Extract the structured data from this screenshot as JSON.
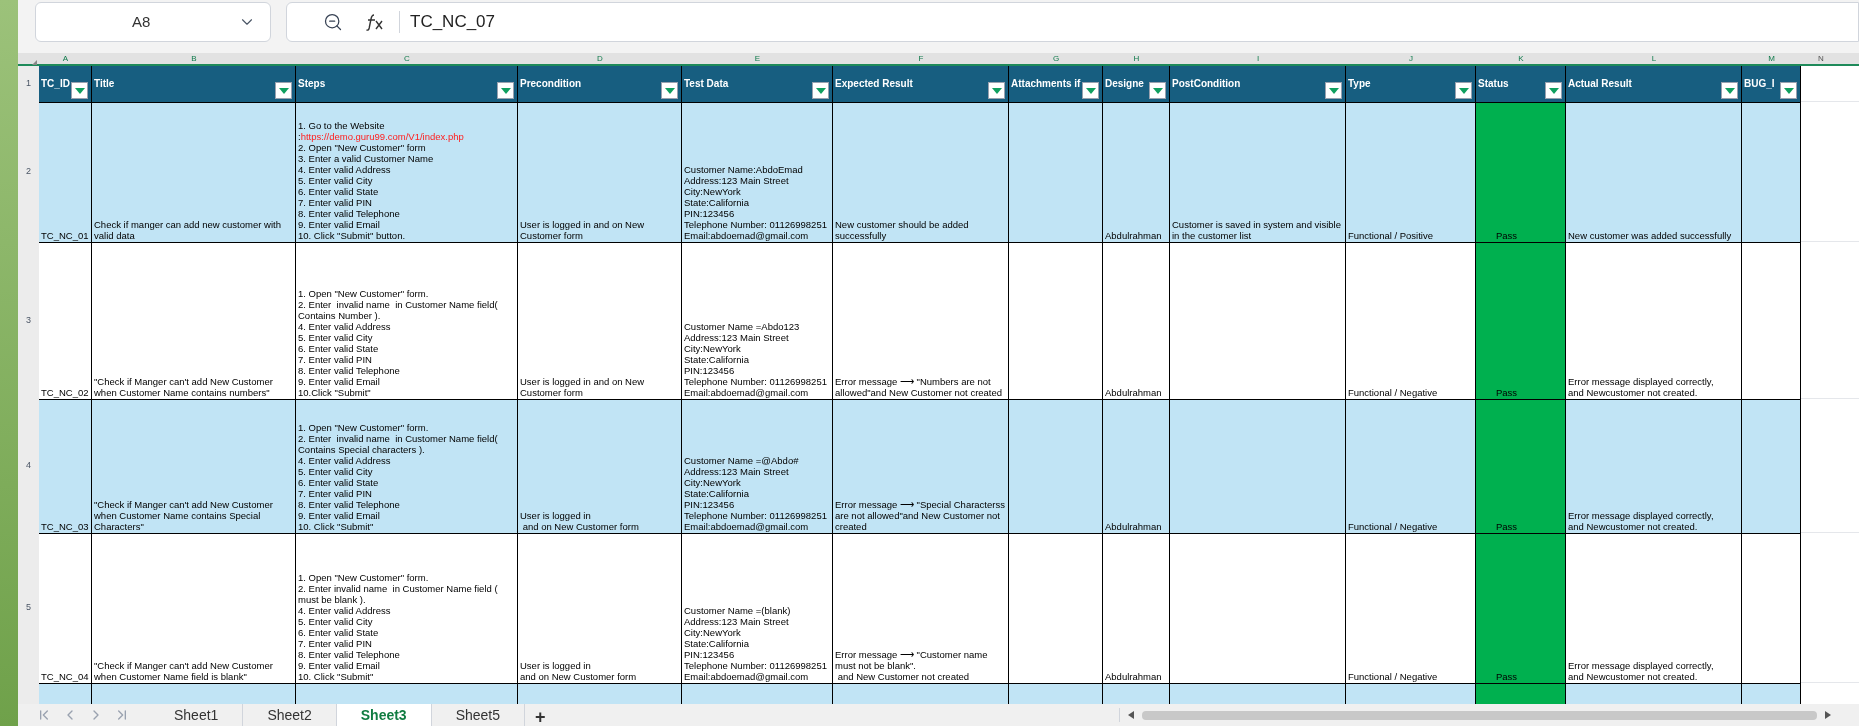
{
  "name_box": {
    "value": "A8"
  },
  "formula_bar": {
    "value": "TC_NC_07"
  },
  "columns": [
    {
      "letter": "A",
      "header": "TC_ID",
      "kind": "text"
    },
    {
      "letter": "B",
      "header": "Title",
      "kind": "text"
    },
    {
      "letter": "C",
      "header": "Steps",
      "kind": "text"
    },
    {
      "letter": "D",
      "header": "Precondition",
      "kind": "text"
    },
    {
      "letter": "E",
      "header": "Test Data",
      "kind": "text"
    },
    {
      "letter": "F",
      "header": "Expected Result",
      "kind": "text"
    },
    {
      "letter": "G",
      "header": "Attachments if",
      "kind": "text"
    },
    {
      "letter": "H",
      "header": "Designe",
      "kind": "text"
    },
    {
      "letter": "I",
      "header": "PostCondition",
      "kind": "text"
    },
    {
      "letter": "J",
      "header": "Type",
      "kind": "text"
    },
    {
      "letter": "K",
      "header": "Status",
      "kind": "status"
    },
    {
      "letter": "L",
      "header": "Actual Result",
      "kind": "text"
    },
    {
      "letter": "M",
      "header": "BUG_I",
      "kind": "text"
    }
  ],
  "extra_column": {
    "letter": "N"
  },
  "header_row_number": "1",
  "rows": [
    {
      "number": "2",
      "cells": [
        "TC_NC_01",
        "Check if manger can add new customer with valid data",
        {
          "segments": [
            {
              "text": "1. Go to the Website\n:"
            },
            {
              "text": "https://demo.guru99.com/V1/index.php",
              "kind": "link"
            },
            {
              "text": "\n2. Open \"New Customer\" form\n3. Enter a valid Customer Name\n4. Enter valid Address\n5. Enter valid City\n6. Enter valid State\n7. Enter valid PIN\n8. Enter valid Telephone\n9. Enter valid Email\n10. Click \"Submit\" button."
            }
          ]
        },
        "User is logged in and on New Customer form",
        "Customer Name:AbdoEmad\nAddress:123 Main Street\nCity:NewYork\nState:California\nPIN:123456\nTelephone Number: 01126998251\nEmail:abdoemad@gmail.com",
        "New customer should be added successfully",
        "",
        "Abdulrahman",
        "Customer is saved in system and visible in the customer list",
        "Functional / Positive",
        "Pass",
        "New customer was added successfully",
        ""
      ]
    },
    {
      "number": "3",
      "cells": [
        "TC_NC_02",
        "\"Check if Manger can't add New Customer when Customer Name contains numbers\"",
        "1. Open \"New Customer\" form.\n2. Enter  invalid name  in Customer Name field( Contains Number ).\n4. Enter valid Address\n5. Enter valid City\n6. Enter valid State\n7. Enter valid PIN\n8. Enter valid Telephone\n9. Enter valid Email\n10.Click \"Submit\"",
        "User is logged in and on New Customer form",
        "Customer Name =Abdo123\nAddress:123 Main Street\nCity:NewYork\nState:California\nPIN:123456\nTelephone Number: 01126998251\nEmail:abdoemad@gmail.com",
        "Error message ⟶ \"Numbers are not allowed\"and New Customer not created",
        "",
        "Abdulrahman",
        "",
        "Functional / Negative",
        "Pass",
        "Error message displayed correctly,\nand Newcustomer not created.",
        ""
      ]
    },
    {
      "number": "4",
      "cells": [
        "TC_NC_03",
        "\"Check if Manger can't add New Customer when Customer Name contains Special Characters\"",
        "1. Open \"New Customer\" form.\n2. Enter  invalid name  in Customer Name field( Contains Special characters ).\n4. Enter valid Address\n5. Enter valid City\n6. Enter valid State\n7. Enter valid PIN\n8. Enter valid Telephone\n9. Enter valid Email\n10. Click \"Submit\"",
        "User is logged in\n and on New Customer form",
        "Customer Name =@Abdo#\nAddress:123 Main Street\nCity:NewYork\nState:California\nPIN:123456\nTelephone Number: 01126998251\nEmail:abdoemad@gmail.com",
        "Error message ⟶ \"Special Characterss are not allowed\"and New Customer not created",
        "",
        "Abdulrahman",
        "",
        "Functional / Negative",
        "Pass",
        "Error message displayed correctly,\nand Newcustomer not created.",
        ""
      ]
    },
    {
      "number": "5",
      "cells": [
        "TC_NC_04",
        "\"Check if Manger can't add New Customer when Customer Name field is blank\"",
        "1. Open \"New Customer\" form.\n2. Enter invalid name  in Customer Name field ( must be blank ).\n4. Enter valid Address\n5. Enter valid City\n6. Enter valid State\n7. Enter valid PIN\n8. Enter valid Telephone\n9. Enter valid Email\n10. Click \"Submit\"",
        "User is logged in\nand on New Customer form",
        "Customer Name =(blank)\nAddress:123 Main Street\nCity:NewYork\nState:California\nPIN:123456\nTelephone Number: 01126998251\nEmail:abdoemad@gmail.com",
        "Error message ⟶ \"Customer name must not be blank\".\n and New Customer not created",
        "",
        "Abdulrahman",
        "",
        "Functional / Negative",
        "Pass",
        "Error message displayed correctly,\nand Newcustomer not created.",
        ""
      ]
    }
  ],
  "sheet_tabs": [
    {
      "label": "Sheet1",
      "selected": false
    },
    {
      "label": "Sheet2",
      "selected": false
    },
    {
      "label": "Sheet3",
      "selected": true
    },
    {
      "label": "Sheet5",
      "selected": false
    }
  ],
  "add_sheet": {
    "label": "+"
  }
}
